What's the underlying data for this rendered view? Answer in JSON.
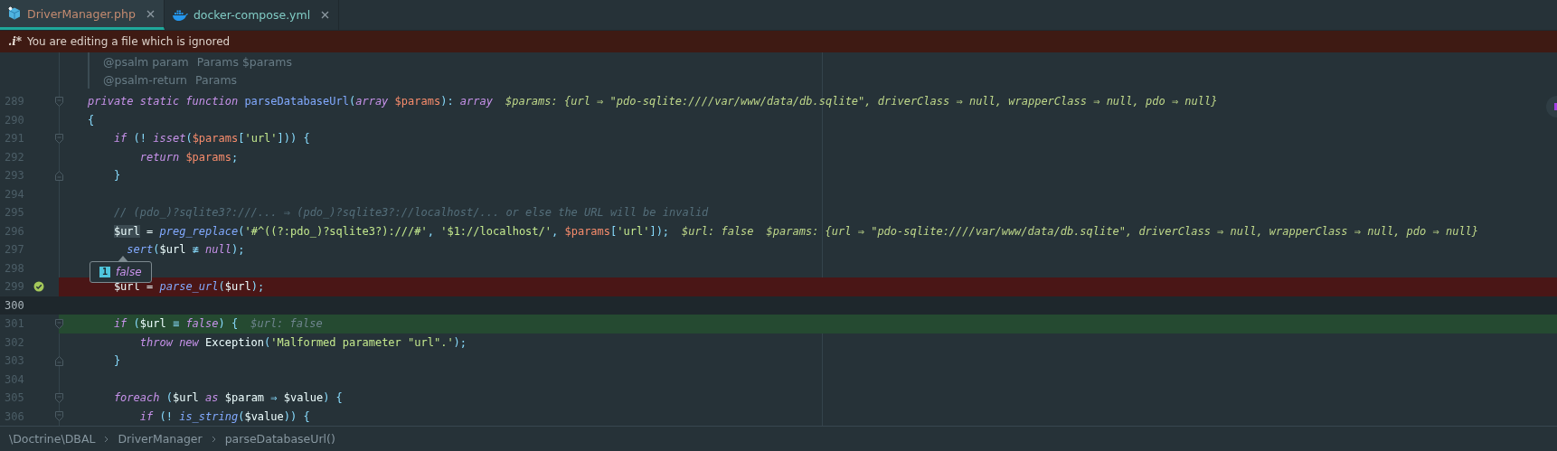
{
  "tabs": [
    {
      "label": "DriverManager.php",
      "kind": "php",
      "color": "#c48b70",
      "selected": true
    },
    {
      "label": "docker-compose.yml",
      "kind": "docker",
      "color": "#80cbc4",
      "selected": false
    }
  ],
  "banner": {
    "badge": ".i*",
    "message": "You are editing a file which is ignored"
  },
  "doc_comment": [
    {
      "tag": "@psalm param",
      "type": "Params $params"
    },
    {
      "tag": "@psalm-return",
      "type": "Params"
    }
  ],
  "lines": [
    {
      "number": "289",
      "failed": false,
      "current": false,
      "passed": false,
      "breakpoint": false,
      "fold_start": true,
      "fold_end": false,
      "tokens": [
        {
          "kind": "kw",
          "text": "private static function "
        },
        {
          "kind": "fn-decl",
          "text": "parseDatabaseUrl"
        },
        {
          "kind": "punc",
          "text": "("
        },
        {
          "kind": "kw",
          "text": "array "
        },
        {
          "kind": "param",
          "text": "$params"
        },
        {
          "kind": "punc",
          "text": "): "
        },
        {
          "kind": "kw",
          "text": "array"
        }
      ],
      "hints": [
        {
          "kind": "value",
          "text": "$params: {url ⇒ \"pdo-sqlite:////var/www/data/db.sqlite\", driverClass ⇒ null, wrapperClass ⇒ null, pdo ⇒ null}"
        }
      ]
    },
    {
      "number": "290",
      "failed": false,
      "current": false,
      "passed": false,
      "breakpoint": false,
      "fold_start": false,
      "fold_end": false,
      "tokens": [
        {
          "kind": "punc",
          "text": "{"
        }
      ]
    },
    {
      "number": "291",
      "failed": false,
      "current": false,
      "passed": false,
      "breakpoint": false,
      "fold_start": true,
      "fold_end": false,
      "tokens": [
        {
          "kind": "kw",
          "text": "    if"
        },
        {
          "kind": "punc",
          "text": " (! "
        },
        {
          "kind": "kw",
          "text": "isset"
        },
        {
          "kind": "punc",
          "text": "("
        },
        {
          "kind": "param",
          "text": "$params"
        },
        {
          "kind": "punc",
          "text": "["
        },
        {
          "kind": "str",
          "text": "'url'"
        },
        {
          "kind": "punc",
          "text": "])) {"
        }
      ]
    },
    {
      "number": "292",
      "failed": false,
      "current": false,
      "passed": false,
      "breakpoint": false,
      "fold_start": false,
      "fold_end": false,
      "tokens": [
        {
          "kind": "kw",
          "text": "        return "
        },
        {
          "kind": "param",
          "text": "$params"
        },
        {
          "kind": "punc",
          "text": ";"
        }
      ]
    },
    {
      "number": "293",
      "failed": false,
      "current": false,
      "passed": false,
      "breakpoint": false,
      "fold_start": false,
      "fold_end": true,
      "tokens": [
        {
          "kind": "punc",
          "text": "    }"
        }
      ]
    },
    {
      "number": "294",
      "failed": false,
      "current": false,
      "passed": false,
      "breakpoint": false,
      "fold_start": false,
      "fold_end": false
    },
    {
      "number": "295",
      "failed": false,
      "current": false,
      "passed": false,
      "breakpoint": false,
      "fold_start": false,
      "fold_end": false,
      "tokens": [
        {
          "kind": "comment",
          "text": "    // (pdo_)?sqlite3?:///... ⇒ (pdo_)?sqlite3?://localhost/... or else the URL will be invalid"
        }
      ]
    },
    {
      "number": "296",
      "failed": false,
      "current": false,
      "passed": false,
      "breakpoint": false,
      "fold_start": false,
      "fold_end": false,
      "tokens": [
        {
          "kind": "var-hl",
          "text": "    $url"
        },
        {
          "kind": "plain",
          "text": " = "
        },
        {
          "kind": "fn-call",
          "text": "preg_replace"
        },
        {
          "kind": "punc",
          "text": "("
        },
        {
          "kind": "str",
          "text": "'#^((?:pdo_)?sqlite3?):///#'"
        },
        {
          "kind": "punc",
          "text": ", "
        },
        {
          "kind": "str",
          "text": "'$1://localhost/'"
        },
        {
          "kind": "punc",
          "text": ", "
        },
        {
          "kind": "param",
          "text": "$params"
        },
        {
          "kind": "punc",
          "text": "["
        },
        {
          "kind": "str",
          "text": "'url'"
        },
        {
          "kind": "punc",
          "text": "]);"
        }
      ],
      "hints": [
        {
          "kind": "value",
          "text": "$url: false"
        },
        {
          "kind": "value",
          "text": "$params: {url ⇒ \"pdo-sqlite:////var/www/data/db.sqlite\", driverClass ⇒ null, wrapperClass ⇒ null, pdo ⇒ null}"
        }
      ]
    },
    {
      "number": "297",
      "failed": false,
      "current": false,
      "passed": false,
      "breakpoint": false,
      "fold_start": false,
      "fold_end": false,
      "tokens": [
        {
          "kind": "fn-call",
          "text": "      sert"
        },
        {
          "kind": "punc",
          "text": "("
        },
        {
          "kind": "plain",
          "text": "$url "
        },
        {
          "kind": "op",
          "text": "≢"
        },
        {
          "kind": "kw",
          "text": " null"
        },
        {
          "kind": "punc",
          "text": ");"
        }
      ],
      "popup": {
        "badge": "1",
        "value": "false"
      }
    },
    {
      "number": "298",
      "failed": false,
      "current": false,
      "passed": false,
      "breakpoint": false,
      "fold_start": false,
      "fold_end": false
    },
    {
      "number": "299",
      "failed": true,
      "current": false,
      "passed": false,
      "breakpoint": true,
      "fold_start": false,
      "fold_end": false,
      "tokens": [
        {
          "kind": "plain",
          "text": "    $url = "
        },
        {
          "kind": "fn-call",
          "text": "parse_url"
        },
        {
          "kind": "punc",
          "text": "("
        },
        {
          "kind": "plain",
          "text": "$url"
        },
        {
          "kind": "punc",
          "text": ");"
        }
      ]
    },
    {
      "number": "300",
      "failed": false,
      "current": true,
      "passed": false,
      "breakpoint": false,
      "fold_start": false,
      "fold_end": false
    },
    {
      "number": "301",
      "failed": false,
      "current": false,
      "passed": true,
      "breakpoint": false,
      "fold_start": true,
      "fold_end": false,
      "tokens": [
        {
          "kind": "kw",
          "text": "    if"
        },
        {
          "kind": "punc",
          "text": " ("
        },
        {
          "kind": "plain",
          "text": "$url "
        },
        {
          "kind": "op",
          "text": "≡"
        },
        {
          "kind": "kw",
          "text": " false"
        },
        {
          "kind": "punc",
          "text": ") {"
        }
      ],
      "hints": [
        {
          "kind": "muted",
          "text": "$url: false"
        }
      ]
    },
    {
      "number": "302",
      "failed": false,
      "current": false,
      "passed": false,
      "breakpoint": false,
      "fold_start": false,
      "fold_end": false,
      "tokens": [
        {
          "kind": "kw",
          "text": "        throw new "
        },
        {
          "kind": "plain",
          "text": "Exception"
        },
        {
          "kind": "punc",
          "text": "("
        },
        {
          "kind": "str",
          "text": "'Malformed parameter \"url\".'"
        },
        {
          "kind": "punc",
          "text": ");"
        }
      ]
    },
    {
      "number": "303",
      "failed": false,
      "current": false,
      "passed": false,
      "breakpoint": false,
      "fold_start": false,
      "fold_end": true,
      "tokens": [
        {
          "kind": "punc",
          "text": "    }"
        }
      ]
    },
    {
      "number": "304",
      "failed": false,
      "current": false,
      "passed": false,
      "breakpoint": false,
      "fold_start": false,
      "fold_end": false
    },
    {
      "number": "305",
      "failed": false,
      "current": false,
      "passed": false,
      "breakpoint": false,
      "fold_start": true,
      "fold_end": false,
      "tokens": [
        {
          "kind": "kw",
          "text": "    foreach"
        },
        {
          "kind": "punc",
          "text": " ("
        },
        {
          "kind": "plain",
          "text": "$url"
        },
        {
          "kind": "kw",
          "text": " as "
        },
        {
          "kind": "plain",
          "text": "$param "
        },
        {
          "kind": "op",
          "text": "⇒"
        },
        {
          "kind": "plain",
          "text": " $value"
        },
        {
          "kind": "punc",
          "text": ") {"
        }
      ]
    },
    {
      "number": "306",
      "failed": false,
      "current": false,
      "passed": false,
      "breakpoint": false,
      "fold_start": true,
      "fold_end": false,
      "tokens": [
        {
          "kind": "kw",
          "text": "        if"
        },
        {
          "kind": "punc",
          "text": " (! "
        },
        {
          "kind": "fn-call",
          "text": "is_string"
        },
        {
          "kind": "punc",
          "text": "("
        },
        {
          "kind": "plain",
          "text": "$value"
        },
        {
          "kind": "punc",
          "text": ")) {"
        }
      ]
    }
  ],
  "breadcrumbs": [
    "\\Doctrine\\DBAL",
    "DriverManager",
    "parseDatabaseUrl()"
  ]
}
